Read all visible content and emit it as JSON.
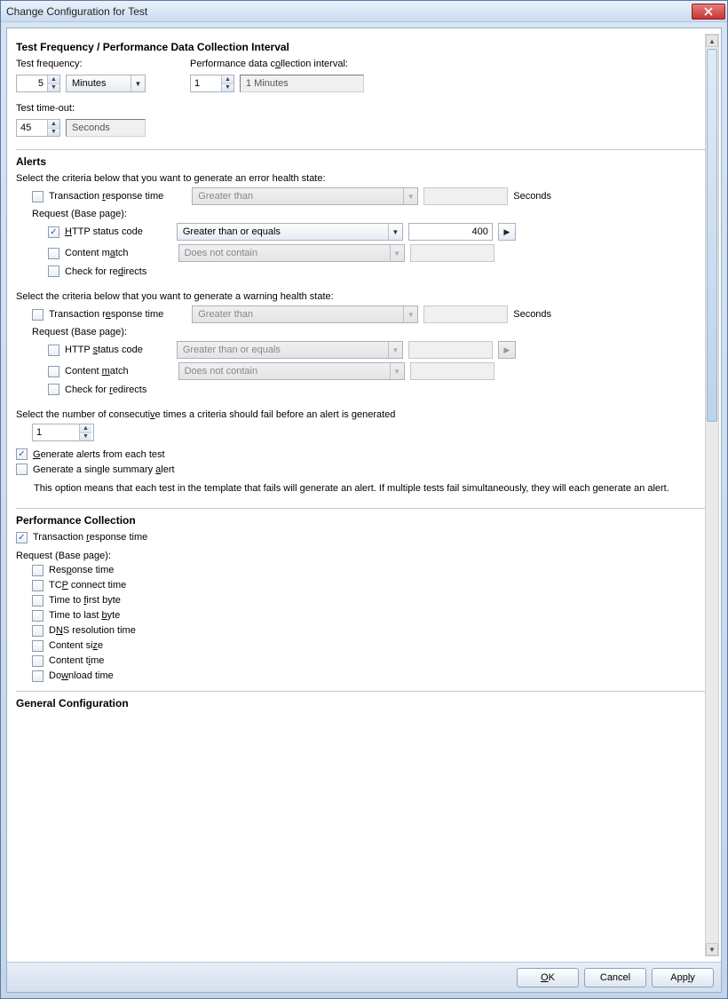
{
  "window": {
    "title": "Change Configuration for Test"
  },
  "freq": {
    "section": "Test Frequency / Performance Data Collection Interval",
    "test_freq_label": "Test frequency:",
    "test_freq_val": "5",
    "test_freq_unit": "Minutes",
    "perf_label": "Performance data collection interval:",
    "perf_val": "1",
    "perf_readonly": "1 Minutes",
    "timeout_label": "Test time-out:",
    "timeout_val": "45",
    "timeout_unit": "Seconds"
  },
  "alerts": {
    "section": "Alerts",
    "error_intro": "Select the criteria below that you want to generate an error health state:",
    "warning_intro": "Select the criteria below that you want to generate a warning health state:",
    "trans_resp": "Transaction response time",
    "greater_than": "Greater than",
    "seconds": "Seconds",
    "request_base": "Request (Base page):",
    "http_status": "HTTP status code",
    "gte": "Greater than or equals",
    "http_err_val": "400",
    "content_match": "Content match",
    "does_not_contain": "Does not contain",
    "check_redirects": "Check for redirects",
    "consec_label": "Select the number of consecutive times a criteria should fail before an alert is generated",
    "consec_val": "1",
    "gen_each": "Generate alerts from each test",
    "gen_single": "Generate a single summary alert",
    "gen_note": "This option means that each test in the template that fails will generate an alert. If multiple tests fail simultaneously, they will each generate an alert."
  },
  "perf": {
    "section": "Performance Collection",
    "trans_resp": "Transaction response time",
    "request_base": "Request (Base page):",
    "resp_time": "Response time",
    "tcp": "TCP connect time",
    "ttfb": "Time to first byte",
    "ttlb": "Time to last byte",
    "dns": "DNS resolution time",
    "csize": "Content size",
    "ctime": "Content time",
    "dl": "Download time"
  },
  "general": {
    "section": "General Configuration"
  },
  "buttons": {
    "ok": "OK",
    "cancel": "Cancel",
    "apply": "Apply"
  }
}
